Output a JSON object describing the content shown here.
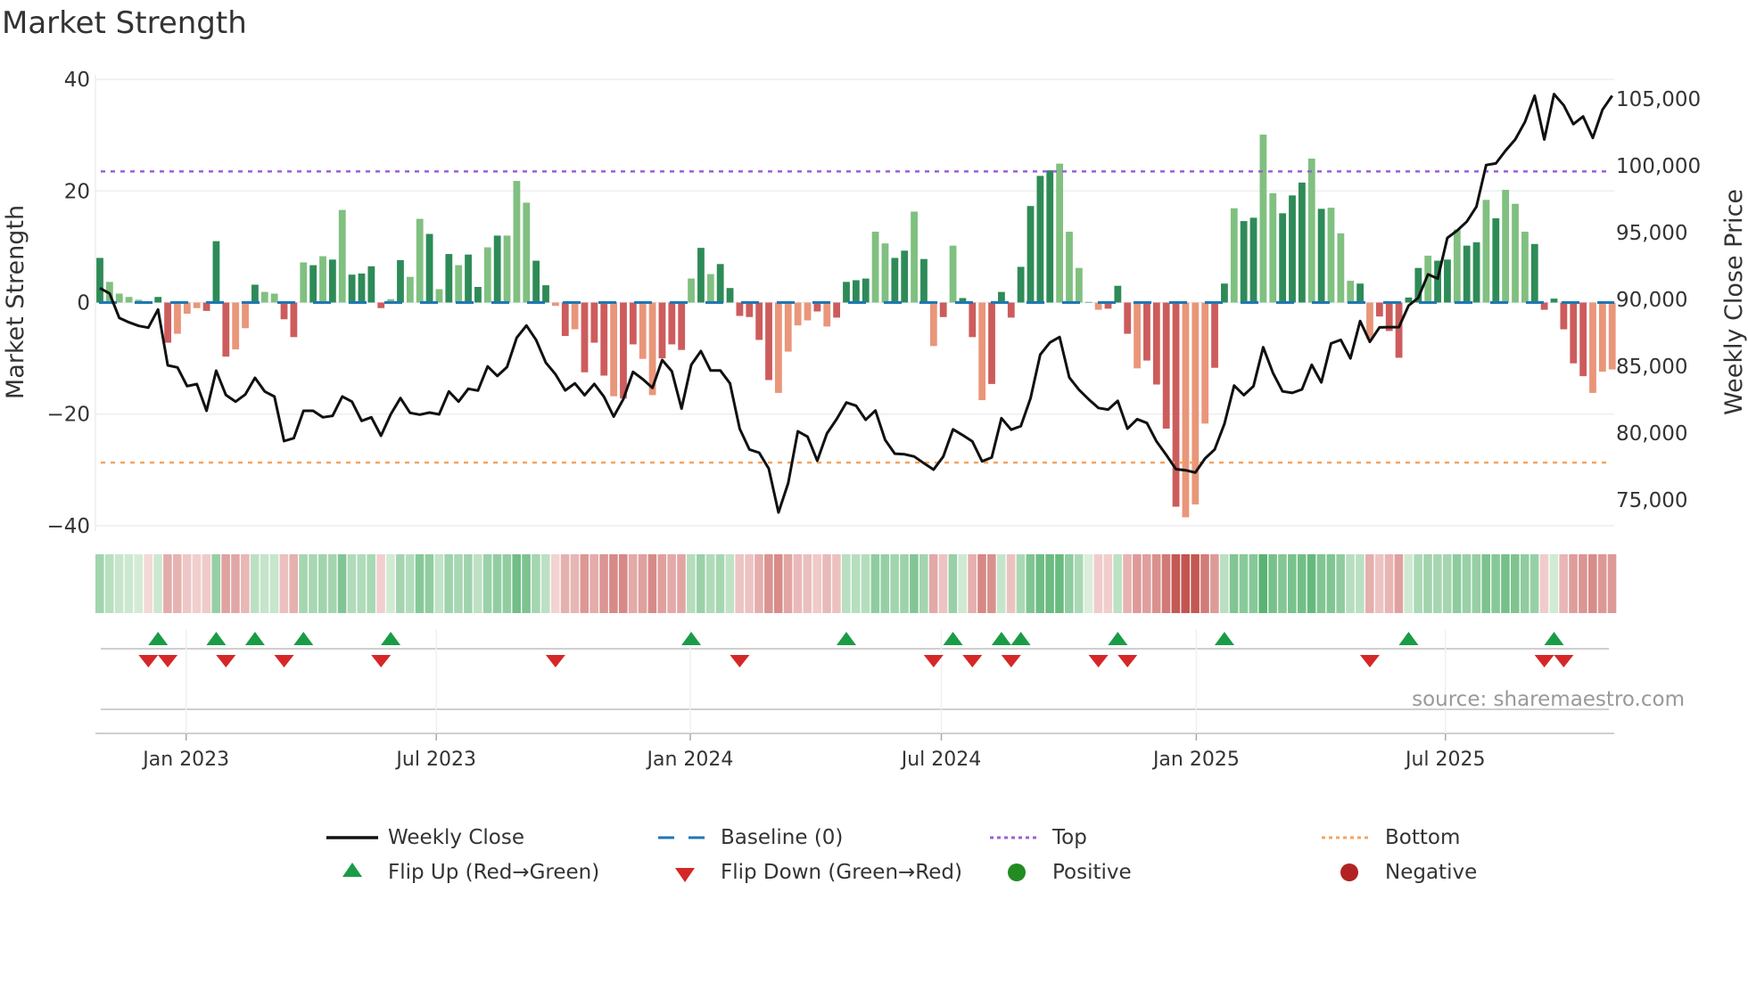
{
  "title": "Market Strength",
  "source": "source: sharemaestro.com",
  "colors": {
    "dark_green": "#2e8b57",
    "light_green": "#80c080",
    "dark_red": "#cd5c5c",
    "light_red": "#e9967a",
    "baseline": "#1f77b4",
    "top": "#9b5fd9",
    "bottom": "#f4a460",
    "close": "#111111",
    "flip_up": "#1a9c47",
    "flip_down": "#d62728",
    "positive": "#228b22",
    "negative": "#b22222"
  },
  "legend": [
    {
      "label": "Weekly Close",
      "icon": "black-line"
    },
    {
      "label": "Baseline (0)",
      "icon": "blue-dashed-line"
    },
    {
      "label": "Top",
      "icon": "purple-dotted-line"
    },
    {
      "label": "Bottom",
      "icon": "orange-dotted-line"
    },
    {
      "label": "Flip Up (Red→Green)",
      "icon": "green-triangle-up"
    },
    {
      "label": "Flip Down (Green→Red)",
      "icon": "red-triangle-down"
    },
    {
      "label": "Positive",
      "icon": "green-circle"
    },
    {
      "label": "Negative",
      "icon": "red-circle"
    }
  ],
  "chart_data": {
    "type": "bar",
    "title": "Market Strength",
    "ylabel": "Market Strength",
    "y2label": "Weekly Close Price",
    "ylim": [
      -42,
      42
    ],
    "yticks": [
      "40",
      "20",
      "0",
      "−20",
      "−40"
    ],
    "ytick_values": [
      40,
      20,
      0,
      -20,
      -40
    ],
    "y2ticks": [
      "105,000",
      "100,000",
      "95,000",
      "90,000",
      "85,000",
      "80,000",
      "75,000"
    ],
    "y2tick_values": [
      105000,
      100000,
      95000,
      90000,
      85000,
      80000,
      75000
    ],
    "xticks": [
      {
        "label": "Jan 2023",
        "week": 8.9
      },
      {
        "label": "Jul 2023",
        "week": 34.7
      },
      {
        "label": "Jan 2024",
        "week": 60.9
      },
      {
        "label": "Jul 2024",
        "week": 86.8
      },
      {
        "label": "Jan 2025",
        "week": 113.1
      },
      {
        "label": "Jul 2025",
        "week": 138.8
      }
    ],
    "top_level": 23.5,
    "bottom_level": -28.7,
    "baseline": 0,
    "strength": [
      8.0,
      3.7,
      1.6,
      1.0,
      0.5,
      -0.2,
      1.0,
      -7.2,
      -5.6,
      -2.0,
      -1.0,
      -1.5,
      11.0,
      -9.7,
      -8.4,
      -4.6,
      3.2,
      1.9,
      1.6,
      -3.0,
      -6.2,
      7.2,
      6.7,
      8.3,
      7.7,
      16.6,
      5.0,
      5.2,
      6.5,
      -1.0,
      0.6,
      7.6,
      4.6,
      15.0,
      12.3,
      2.4,
      8.7,
      6.7,
      8.6,
      2.8,
      9.9,
      12.0,
      12.0,
      21.8,
      17.9,
      7.5,
      3.1,
      -0.6,
      -6.0,
      -4.8,
      -12.5,
      -7.2,
      -13.1,
      -16.8,
      -17.2,
      -7.5,
      -10.1,
      -16.6,
      -10.0,
      -7.5,
      -8.5,
      4.3,
      9.8,
      5.1,
      6.9,
      2.6,
      -2.4,
      -2.6,
      -6.7,
      -13.9,
      -16.2,
      -8.8,
      -4.1,
      -3.2,
      -1.6,
      -4.3,
      -2.7,
      3.7,
      4.0,
      4.3,
      12.7,
      10.6,
      8.0,
      9.3,
      16.3,
      7.8,
      -7.8,
      -2.6,
      10.2,
      0.8,
      -6.2,
      -17.5,
      -14.6,
      1.9,
      -2.7,
      6.4,
      17.3,
      22.7,
      23.7,
      24.9,
      12.7,
      6.2,
      0.1,
      -1.3,
      -1.1,
      3.0,
      -5.6,
      -11.8,
      -10.4,
      -14.7,
      -22.6,
      -36.6,
      -38.5,
      -36.2,
      -21.7,
      -11.7,
      3.4,
      16.9,
      14.6,
      15.2,
      30.1,
      19.6,
      16.0,
      19.2,
      21.5,
      25.8,
      16.8,
      17.0,
      12.4,
      3.9,
      3.4,
      -6.5,
      -2.5,
      -5.1,
      -9.9,
      0.9,
      6.2,
      8.4,
      7.5,
      7.7,
      13.1,
      10.2,
      10.8,
      18.4,
      15.1,
      20.2,
      17.7,
      12.7,
      10.5,
      -1.3,
      0.7,
      -4.8,
      -10.9,
      -13.2,
      -16.2,
      -12.4,
      -12.0
    ],
    "shade": "dlllldddllldddlldllddldldlddddldlldldlddldlllddldldddlddlldddldlddddddlllldlddddllddldldlddlddddddd llldldddlddddlllddlddlldddldllldldddddlddlddldlllddddddll",
    "weekly_close": [
      90845,
      90444,
      88622,
      88289,
      88022,
      87889,
      89244,
      85067,
      84911,
      83511,
      83667,
      81667,
      84667,
      82844,
      82356,
      82889,
      84133,
      83111,
      82733,
      79400,
      79622,
      81667,
      81667,
      81178,
      81289,
      82733,
      82356,
      80911,
      81178,
      79800,
      81400,
      82622,
      81511,
      81378,
      81533,
      81400,
      83111,
      82356,
      83311,
      83178,
      84988,
      84271,
      84940,
      87140,
      88048,
      86972,
      85275,
      84390,
      83194,
      83720,
      82836,
      83673,
      82717,
      81234,
      82549,
      84581,
      84032,
      83386,
      85466,
      84629,
      81832,
      85107,
      86136,
      84677,
      84677,
      83721,
      80326,
      78772,
      78532,
      77337,
      74061,
      76261,
      80135,
      79728,
      77935,
      79967,
      81043,
      82287,
      82048,
      80996,
      81689,
      79489,
      78461,
      78413,
      78246,
      77744,
      77266,
      78246,
      80278,
      79848,
      79370,
      77887,
      78174,
      81115,
      80254,
      80517,
      82597,
      85873,
      86781,
      87188,
      84151,
      83243,
      82525,
      81880,
      81760,
      82405,
      80326,
      81043,
      80756,
      79370,
      78366,
      77300,
      77220,
      77050,
      78100,
      78772,
      80684,
      83554,
      82837,
      83506,
      86423,
      84510,
      83123,
      83004,
      83267,
      85108,
      83793,
      86710,
      86973,
      85586,
      88383,
      86829,
      87905,
      87929,
      87929,
      89531,
      90129,
      91874,
      91563,
      94600,
      95150,
      95819,
      96943,
      100052,
      100171,
      101128,
      101964,
      103279,
      105240,
      101964,
      105360,
      104523,
      103112,
      103686,
      102084,
      104188,
      105240
    ],
    "flip_up_weeks": [
      6,
      12,
      16,
      21,
      30,
      61,
      77,
      88,
      93,
      95,
      105,
      116,
      135,
      150
    ],
    "flip_down_weeks": [
      5,
      7,
      13,
      19,
      29,
      47,
      66,
      86,
      90,
      94,
      103,
      106,
      131,
      149,
      151
    ],
    "legend_position": "bottom"
  }
}
